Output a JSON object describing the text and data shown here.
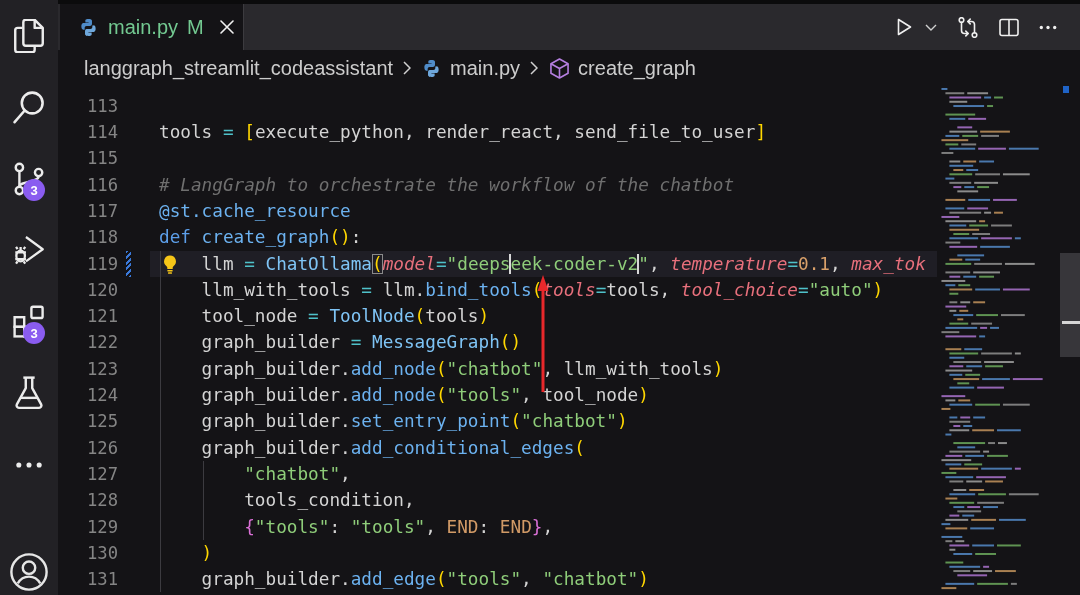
{
  "activity_bar": {
    "source_control_badge": "3",
    "extensions_badge": "3"
  },
  "tabs": [
    {
      "label": "main.py",
      "status": "M",
      "selected": true
    }
  ],
  "breadcrumb": {
    "folder": "langgraph_streamlit_codeassistant",
    "file": "main.py",
    "symbol": "create_graph"
  },
  "editor": {
    "lines": [
      {
        "number": "113",
        "current": false,
        "modified": false,
        "lightbulb": false
      },
      {
        "number": "114",
        "current": false,
        "modified": false,
        "lightbulb": false,
        "tokens": [
          {
            "kind": "plain",
            "text": "tools "
          },
          {
            "kind": "op",
            "text": "= "
          },
          {
            "kind": "bracket",
            "text": "["
          },
          {
            "kind": "plain",
            "text": "execute_python, render_react, send_file_to_user"
          },
          {
            "kind": "bracket",
            "text": "]"
          }
        ]
      },
      {
        "number": "115",
        "current": false,
        "modified": false,
        "lightbulb": false
      },
      {
        "number": "116",
        "current": false,
        "modified": false,
        "lightbulb": false,
        "tokens": [
          {
            "kind": "comment",
            "text": "# LangGraph to orchestrate the workflow of the chatbot"
          }
        ]
      },
      {
        "number": "117",
        "current": false,
        "modified": false,
        "lightbulb": false,
        "tokens": [
          {
            "kind": "decorator",
            "text": "@st.cache_resource"
          }
        ]
      },
      {
        "number": "118",
        "current": false,
        "modified": false,
        "lightbulb": false,
        "tokens": [
          {
            "kind": "keyword",
            "text": "def "
          },
          {
            "kind": "func",
            "text": "create_graph"
          },
          {
            "kind": "bracket",
            "text": "()"
          },
          {
            "kind": "plain",
            "text": ":"
          }
        ]
      },
      {
        "number": "119",
        "current": true,
        "modified": true,
        "lightbulb": true,
        "tokens": [
          {
            "kind": "plain",
            "text": "    llm "
          },
          {
            "kind": "op",
            "text": "= "
          },
          {
            "kind": "class",
            "text": "ChatOllama"
          },
          {
            "kind": "matched_bracket",
            "text": "("
          },
          {
            "kind": "param",
            "text": "model"
          },
          {
            "kind": "op",
            "text": "="
          },
          {
            "kind": "string",
            "text": "\"deeps"
          },
          {
            "kind": "caret"
          },
          {
            "kind": "string",
            "text": "eek-coder-v2"
          },
          {
            "kind": "caret"
          },
          {
            "kind": "string",
            "text": "\""
          },
          {
            "kind": "plain",
            "text": ", "
          },
          {
            "kind": "param",
            "text": "temperature"
          },
          {
            "kind": "op",
            "text": "="
          },
          {
            "kind": "number",
            "text": "0.1"
          },
          {
            "kind": "plain",
            "text": ", "
          },
          {
            "kind": "param",
            "text": "max_tok"
          }
        ]
      },
      {
        "number": "120",
        "current": false,
        "modified": false,
        "lightbulb": false,
        "tokens": [
          {
            "kind": "plain",
            "text": "    llm_with_tools "
          },
          {
            "kind": "op",
            "text": "="
          },
          {
            "kind": "plain",
            "text": " llm."
          },
          {
            "kind": "func",
            "text": "bind_tools"
          },
          {
            "kind": "bracket",
            "text": "("
          },
          {
            "kind": "param",
            "text": "tools"
          },
          {
            "kind": "op",
            "text": "="
          },
          {
            "kind": "plain",
            "text": "tools, "
          },
          {
            "kind": "param",
            "text": "tool_choice"
          },
          {
            "kind": "op",
            "text": "="
          },
          {
            "kind": "string",
            "text": "\"auto\""
          },
          {
            "kind": "bracket",
            "text": ")"
          }
        ]
      },
      {
        "number": "121",
        "current": false,
        "modified": false,
        "lightbulb": false,
        "tokens": [
          {
            "kind": "plain",
            "text": "    tool_node "
          },
          {
            "kind": "op",
            "text": "= "
          },
          {
            "kind": "class",
            "text": "ToolNode"
          },
          {
            "kind": "bracket",
            "text": "("
          },
          {
            "kind": "plain",
            "text": "tools"
          },
          {
            "kind": "bracket",
            "text": ")"
          }
        ]
      },
      {
        "number": "122",
        "current": false,
        "modified": false,
        "lightbulb": false,
        "tokens": [
          {
            "kind": "plain",
            "text": "    graph_builder "
          },
          {
            "kind": "op",
            "text": "= "
          },
          {
            "kind": "class",
            "text": "MessageGraph"
          },
          {
            "kind": "bracket",
            "text": "()"
          }
        ]
      },
      {
        "number": "123",
        "current": false,
        "modified": false,
        "lightbulb": false,
        "tokens": [
          {
            "kind": "plain",
            "text": "    graph_builder."
          },
          {
            "kind": "func",
            "text": "add_node"
          },
          {
            "kind": "bracket",
            "text": "("
          },
          {
            "kind": "string",
            "text": "\"chatbot\""
          },
          {
            "kind": "plain",
            "text": ", llm_with_tools"
          },
          {
            "kind": "bracket",
            "text": ")"
          }
        ]
      },
      {
        "number": "124",
        "current": false,
        "modified": false,
        "lightbulb": false,
        "tokens": [
          {
            "kind": "plain",
            "text": "    graph_builder."
          },
          {
            "kind": "func",
            "text": "add_node"
          },
          {
            "kind": "bracket",
            "text": "("
          },
          {
            "kind": "string",
            "text": "\"tools\""
          },
          {
            "kind": "plain",
            "text": ", tool_node"
          },
          {
            "kind": "bracket",
            "text": ")"
          }
        ]
      },
      {
        "number": "125",
        "current": false,
        "modified": false,
        "lightbulb": false,
        "tokens": [
          {
            "kind": "plain",
            "text": "    graph_builder."
          },
          {
            "kind": "func",
            "text": "set_entry_point"
          },
          {
            "kind": "bracket",
            "text": "("
          },
          {
            "kind": "string",
            "text": "\"chatbot\""
          },
          {
            "kind": "bracket",
            "text": ")"
          }
        ]
      },
      {
        "number": "126",
        "current": false,
        "modified": false,
        "lightbulb": false,
        "tokens": [
          {
            "kind": "plain",
            "text": "    graph_builder."
          },
          {
            "kind": "func",
            "text": "add_conditional_edges"
          },
          {
            "kind": "bracket",
            "text": "("
          }
        ]
      },
      {
        "number": "127",
        "current": false,
        "modified": false,
        "lightbulb": false,
        "tokens": [
          {
            "kind": "string",
            "text": "        \"chatbot\""
          },
          {
            "kind": "plain",
            "text": ","
          }
        ]
      },
      {
        "number": "128",
        "current": false,
        "modified": false,
        "lightbulb": false,
        "tokens": [
          {
            "kind": "plain",
            "text": "        tools_condition,"
          }
        ]
      },
      {
        "number": "129",
        "current": false,
        "modified": false,
        "lightbulb": false,
        "tokens": [
          {
            "kind": "bracket2",
            "text": "        {"
          },
          {
            "kind": "string",
            "text": "\"tools\""
          },
          {
            "kind": "plain",
            "text": ": "
          },
          {
            "kind": "string",
            "text": "\"tools\""
          },
          {
            "kind": "plain",
            "text": ", "
          },
          {
            "kind": "constant",
            "text": "END"
          },
          {
            "kind": "plain",
            "text": ": "
          },
          {
            "kind": "constant",
            "text": "END"
          },
          {
            "kind": "bracket2",
            "text": "}"
          },
          {
            "kind": "plain",
            "text": ","
          }
        ]
      },
      {
        "number": "130",
        "current": false,
        "modified": false,
        "lightbulb": false,
        "tokens": [
          {
            "kind": "bracket",
            "text": "    )"
          }
        ]
      },
      {
        "number": "131",
        "current": false,
        "modified": false,
        "lightbulb": false,
        "tokens": [
          {
            "kind": "plain",
            "text": "    graph_builder."
          },
          {
            "kind": "func",
            "text": "add_edge"
          },
          {
            "kind": "bracket",
            "text": "("
          },
          {
            "kind": "string",
            "text": "\"tools\""
          },
          {
            "kind": "plain",
            "text": ", "
          },
          {
            "kind": "string",
            "text": "\"chatbot\""
          },
          {
            "kind": "bracket",
            "text": ")"
          }
        ]
      }
    ]
  }
}
